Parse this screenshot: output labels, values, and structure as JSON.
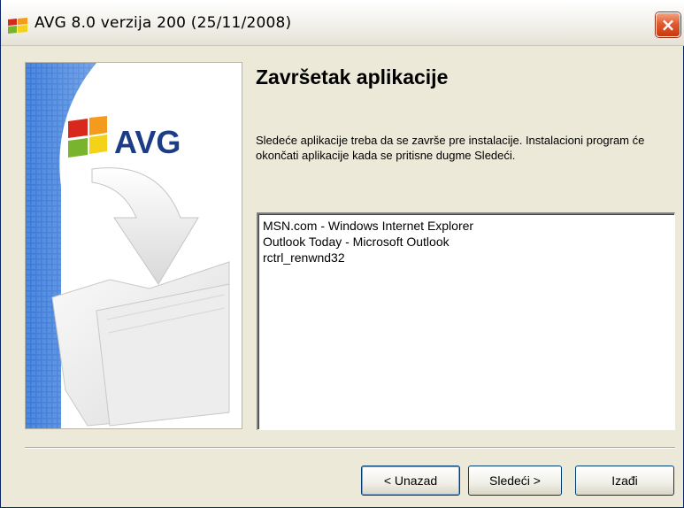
{
  "window": {
    "title": "AVG 8.0 verzija 200 (25/11/2008)",
    "close_label": "×"
  },
  "side_panel": {
    "logo_text": "AVG"
  },
  "main": {
    "heading": "Završetak aplikacije",
    "description": "Sledeće aplikacije treba da se završe pre instalacije. Instalacioni program će okončati aplikacije kada se pritisne dugme Sledeći.",
    "applications": [
      "MSN.com - Windows Internet Explorer",
      "Outlook Today - Microsoft Outlook",
      "rctrl_renwnd32"
    ]
  },
  "buttons": {
    "back": "< Unazad",
    "next": "Sledeći >",
    "exit": "Izađi"
  },
  "colors": {
    "accent_blue": "#3d7bd6",
    "brand_red": "#d8281e",
    "brand_orange": "#f49a1c",
    "brand_green": "#79b42e",
    "brand_yellow": "#f5d21a"
  }
}
